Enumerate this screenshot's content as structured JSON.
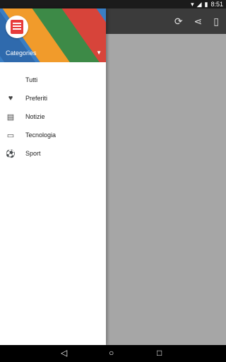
{
  "status": {
    "time": "8:51"
  },
  "app_bar": {
    "actions": [
      "refresh-icon",
      "share-icon",
      "phone-icon"
    ]
  },
  "drawer": {
    "header": {
      "categories_label": "Categories"
    },
    "items": [
      {
        "label": "Tutti",
        "icon": ""
      },
      {
        "label": "Preferiti",
        "icon": "heart-icon"
      },
      {
        "label": "Notizie",
        "icon": "newspaper-icon"
      },
      {
        "label": "Tecnologia",
        "icon": "monitor-icon"
      },
      {
        "label": "Sport",
        "icon": "soccer-ball-icon"
      }
    ]
  },
  "nav_bar": {
    "buttons": [
      "back-icon",
      "home-icon",
      "recents-icon"
    ]
  }
}
